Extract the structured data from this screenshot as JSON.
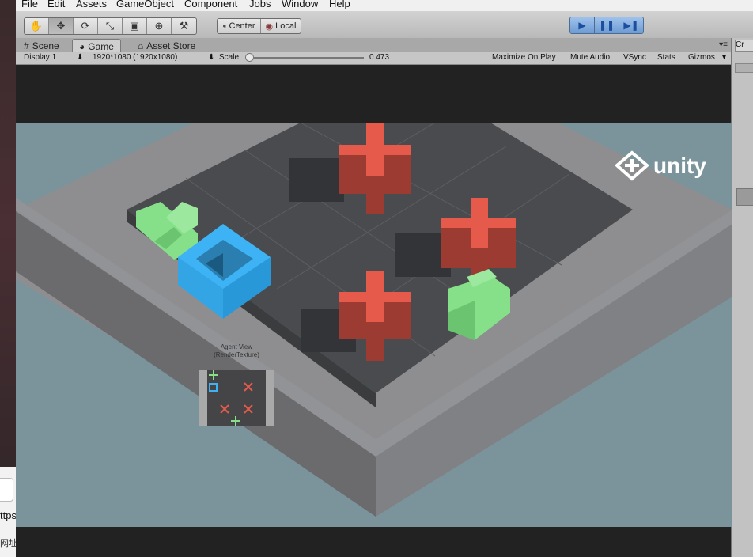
{
  "desktop": {
    "text1": "ttps",
    "text2": "网址"
  },
  "menu": [
    "File",
    "Edit",
    "Assets",
    "GameObject",
    "Component",
    "Jobs",
    "Window",
    "Help"
  ],
  "toolbar": {
    "tools": [
      "hand-icon",
      "move-icon",
      "rotate-icon",
      "scale-icon",
      "rect-icon",
      "transform-icon",
      "custom-tool-icon"
    ],
    "pivot_label": "Center",
    "space_label": "Local",
    "play_controls": [
      "play-icon",
      "pause-icon",
      "step-icon"
    ]
  },
  "tabs": {
    "scene": "Scene",
    "game": "Game",
    "asset_store": "Asset Store"
  },
  "gamebar": {
    "display": "Display 1",
    "resolution": "1920*1080 (1920x1080)",
    "scale_label": "Scale",
    "scale_value": "0.473",
    "maximize": "Maximize On Play",
    "mute": "Mute Audio",
    "vsync": "VSync",
    "stats": "Stats",
    "gizmos": "Gizmos"
  },
  "right_panel": {
    "header": "Cr"
  },
  "game": {
    "logo_text": "unity",
    "agent_view_title": "Agent View",
    "agent_view_subtitle": "(RenderTexture)"
  },
  "colors": {
    "sky": "#7b949b",
    "wall_top": "#8e8e90",
    "floor": "#4a4b4e",
    "red_top": "#e55a4b",
    "red_side": "#9c3b32",
    "green": "#86e08a",
    "blue": "#3db3f5"
  }
}
